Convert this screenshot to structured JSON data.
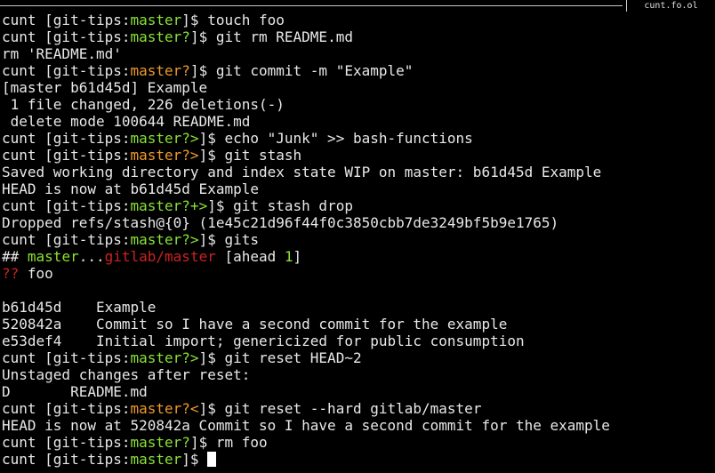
{
  "window": {
    "title": "cunt.fo.ol"
  },
  "colors": {
    "background": "#000000",
    "text": "#e8e8e8",
    "branch_clean": "#8ae234",
    "branch_dirty": "#ef9a2a",
    "remote_branch": "#cc2222"
  },
  "terminal": {
    "lines": [
      [
        {
          "t": "cunt [git-tips:",
          "c": "default"
        },
        {
          "t": "master",
          "c": "green"
        },
        {
          "t": "]$ touch foo",
          "c": "default"
        }
      ],
      [
        {
          "t": "cunt [git-tips:",
          "c": "default"
        },
        {
          "t": "master?",
          "c": "green"
        },
        {
          "t": "]$ git rm README.md",
          "c": "default"
        }
      ],
      [
        {
          "t": "rm 'README.md'",
          "c": "default"
        }
      ],
      [
        {
          "t": "cunt [git-tips:",
          "c": "default"
        },
        {
          "t": "master?",
          "c": "orange"
        },
        {
          "t": "]$ git commit -m \"Example\"",
          "c": "default"
        }
      ],
      [
        {
          "t": "[master b61d45d] Example",
          "c": "default"
        }
      ],
      [
        {
          "t": " 1 file changed, 226 deletions(-)",
          "c": "default"
        }
      ],
      [
        {
          "t": " delete mode 100644 README.md",
          "c": "default"
        }
      ],
      [
        {
          "t": "cunt [git-tips:",
          "c": "default"
        },
        {
          "t": "master?>",
          "c": "green"
        },
        {
          "t": "]$ echo \"Junk\" >> bash-functions",
          "c": "default"
        }
      ],
      [
        {
          "t": "cunt [git-tips:",
          "c": "default"
        },
        {
          "t": "master?>",
          "c": "orange"
        },
        {
          "t": "]$ git stash",
          "c": "default"
        }
      ],
      [
        {
          "t": "Saved working directory and index state WIP on master: b61d45d Example",
          "c": "default"
        }
      ],
      [
        {
          "t": "HEAD is now at b61d45d Example",
          "c": "default"
        }
      ],
      [
        {
          "t": "cunt [git-tips:",
          "c": "default"
        },
        {
          "t": "master?+>",
          "c": "green"
        },
        {
          "t": "]$ git stash drop",
          "c": "default"
        }
      ],
      [
        {
          "t": "Dropped refs/stash@{0} (1e45c21d96f44f0c3850cbb7de3249bf5b9e1765)",
          "c": "default"
        }
      ],
      [
        {
          "t": "cunt [git-tips:",
          "c": "default"
        },
        {
          "t": "master?>",
          "c": "green"
        },
        {
          "t": "]$ gits",
          "c": "default"
        }
      ],
      [
        {
          "t": "## ",
          "c": "default"
        },
        {
          "t": "master",
          "c": "green"
        },
        {
          "t": "...",
          "c": "default"
        },
        {
          "t": "gitlab/master",
          "c": "red"
        },
        {
          "t": " [ahead ",
          "c": "default"
        },
        {
          "t": "1",
          "c": "green"
        },
        {
          "t": "]",
          "c": "default"
        }
      ],
      [
        {
          "t": "??",
          "c": "red"
        },
        {
          "t": " foo",
          "c": "default"
        }
      ],
      [],
      [
        {
          "t": "b61d45d    Example",
          "c": "default"
        }
      ],
      [
        {
          "t": "520842a    Commit so I have a second commit for the example",
          "c": "default"
        }
      ],
      [
        {
          "t": "e53def4    Initial import; genericized for public consumption",
          "c": "default"
        }
      ],
      [
        {
          "t": "cunt [git-tips:",
          "c": "default"
        },
        {
          "t": "master?>",
          "c": "green"
        },
        {
          "t": "]$ git reset HEAD~2",
          "c": "default"
        }
      ],
      [
        {
          "t": "Unstaged changes after reset:",
          "c": "default"
        }
      ],
      [
        {
          "t": "D       README.md",
          "c": "default"
        }
      ],
      [
        {
          "t": "cunt [git-tips:",
          "c": "default"
        },
        {
          "t": "master?<",
          "c": "orange"
        },
        {
          "t": "]$ git reset --hard gitlab/master",
          "c": "default"
        }
      ],
      [
        {
          "t": "HEAD is now at 520842a Commit so I have a second commit for the example",
          "c": "default"
        }
      ],
      [
        {
          "t": "cunt [git-tips:",
          "c": "default"
        },
        {
          "t": "master?",
          "c": "green"
        },
        {
          "t": "]$ rm foo",
          "c": "default"
        }
      ],
      [
        {
          "t": "cunt [git-tips:",
          "c": "default"
        },
        {
          "t": "master",
          "c": "green"
        },
        {
          "t": "]$ ",
          "c": "default"
        }
      ]
    ]
  }
}
